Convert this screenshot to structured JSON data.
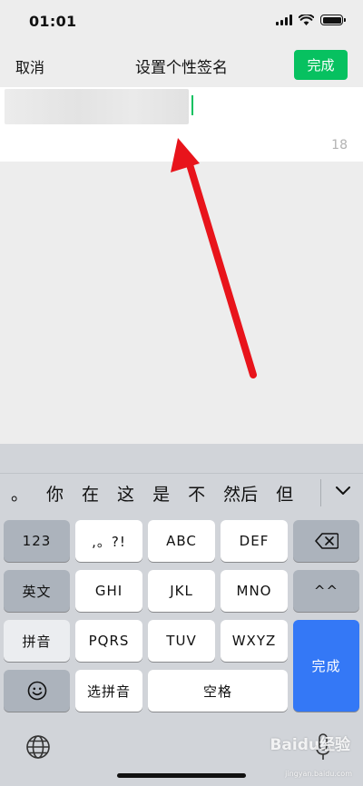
{
  "status_bar": {
    "time": "01:01"
  },
  "nav": {
    "cancel_label": "取消",
    "title": "设置个性签名",
    "done_label": "完成"
  },
  "editor": {
    "remaining_count": "18"
  },
  "keyboard": {
    "candidates": [
      "。",
      "你",
      "在",
      "这",
      "是",
      "不",
      "然后",
      "但"
    ],
    "keys": {
      "k123": "123",
      "punct": ",。?!",
      "abc": "ABC",
      "def": "DEF",
      "english": "英文",
      "ghi": "GHI",
      "jkl": "JKL",
      "mno": "MNO",
      "emoticon": "^^",
      "pinyin": "拼音",
      "pqrs": "PQRS",
      "tuv": "TUV",
      "wxyz": "WXYZ",
      "select_pinyin": "选拼音",
      "space": "空格",
      "done": "完成"
    }
  },
  "watermark": {
    "brand": "Baidu经验",
    "url": "jingyan.baidu.com"
  },
  "colors": {
    "accent_green": "#07c160",
    "keyboard_blue": "#3478f6",
    "annotation_red": "#e8141b"
  }
}
